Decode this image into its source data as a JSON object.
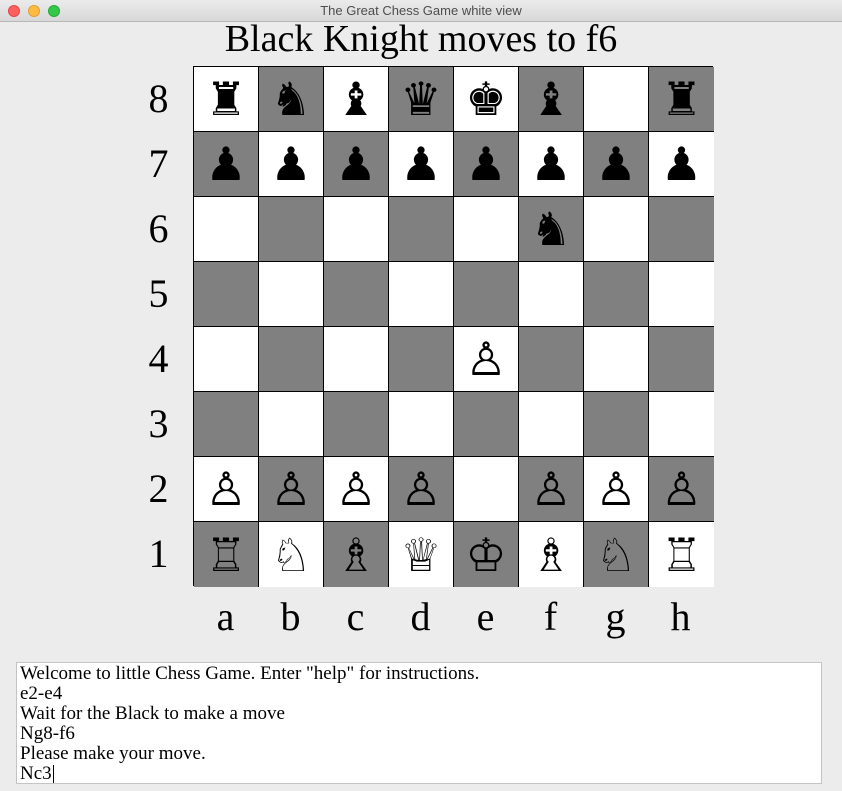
{
  "window": {
    "title": "The Great Chess Game white view"
  },
  "heading": "Black Knight moves to f6",
  "board": {
    "light_color": "#ffffff",
    "dark_color": "#808080",
    "ranks": [
      "8",
      "7",
      "6",
      "5",
      "4",
      "3",
      "2",
      "1"
    ],
    "files": [
      "a",
      "b",
      "c",
      "d",
      "e",
      "f",
      "g",
      "h"
    ],
    "rows": [
      [
        "♜",
        "♞",
        "♝",
        "♛",
        "♚",
        "♝",
        "",
        "♜"
      ],
      [
        "♟",
        "♟",
        "♟",
        "♟",
        "♟",
        "♟",
        "♟",
        "♟"
      ],
      [
        "",
        "",
        "",
        "",
        "",
        "♞",
        "",
        ""
      ],
      [
        "",
        "",
        "",
        "",
        "",
        "",
        "",
        ""
      ],
      [
        "",
        "",
        "",
        "",
        "♙",
        "",
        "",
        ""
      ],
      [
        "",
        "",
        "",
        "",
        "",
        "",
        "",
        ""
      ],
      [
        "♙",
        "♙",
        "♙",
        "♙",
        "",
        "♙",
        "♙",
        "♙"
      ],
      [
        "♖",
        "♘",
        "♗",
        "♕",
        "♔",
        "♗",
        "♘",
        "♖"
      ]
    ]
  },
  "console": {
    "lines": [
      "Welcome to little Chess Game. Enter \"help\" for instructions.",
      "e2-e4",
      "Wait for the Black to make a move",
      "Ng8-f6",
      "Please make your move."
    ],
    "input_value": "Nc3"
  }
}
